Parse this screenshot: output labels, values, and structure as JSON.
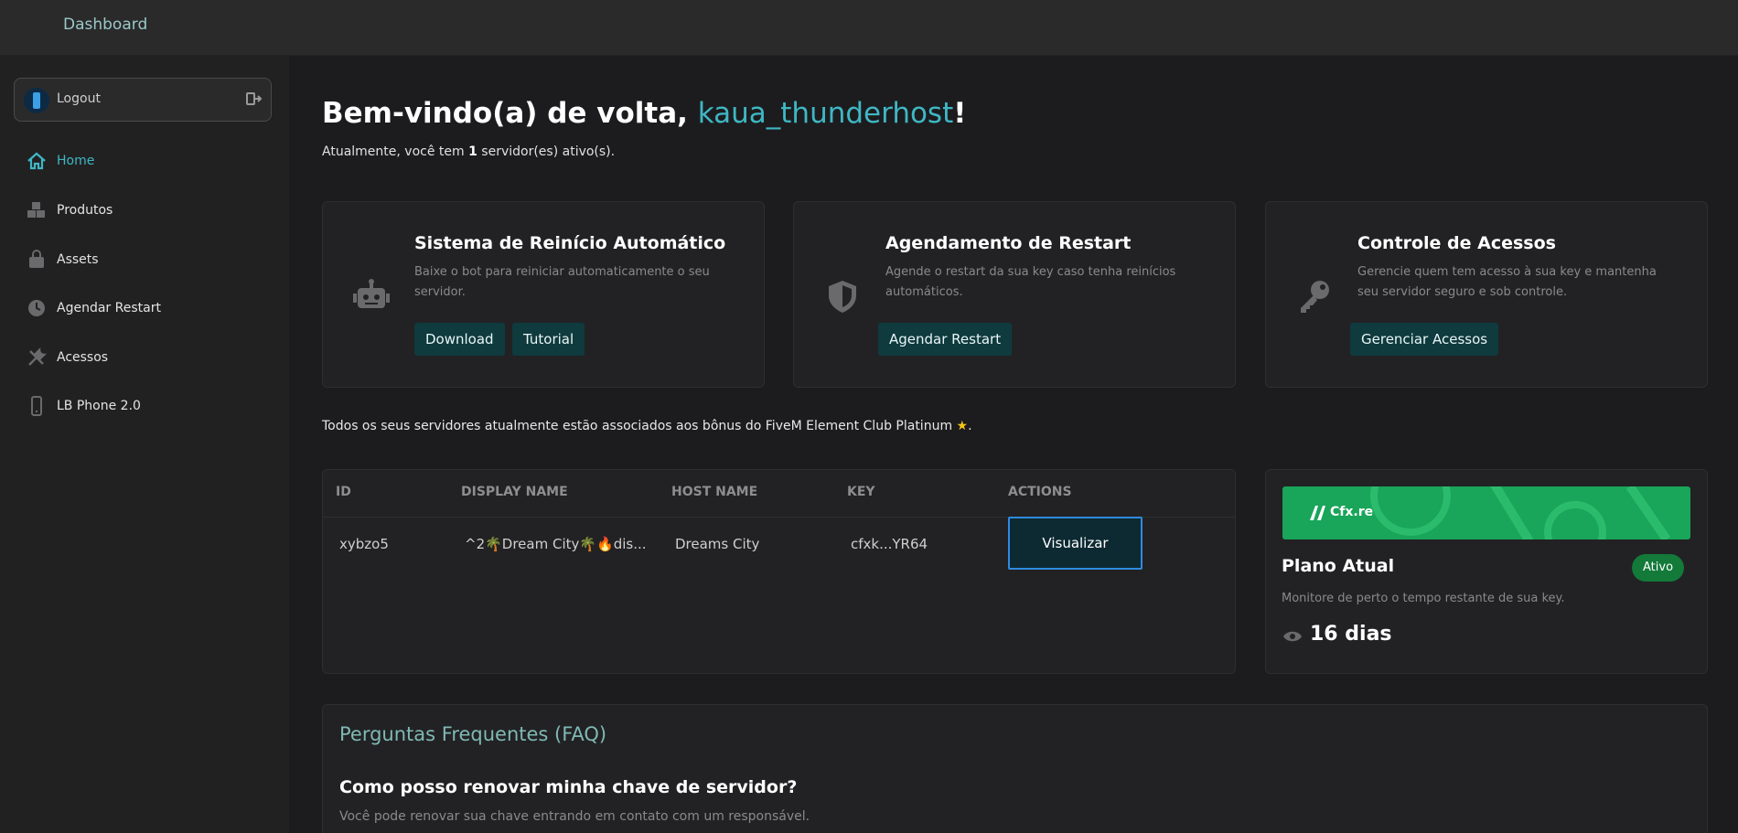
{
  "topbar": {
    "title": "Dashboard"
  },
  "sidebar": {
    "logout_label": "Logout",
    "items": [
      {
        "label": "Home",
        "icon": "home-icon"
      },
      {
        "label": "Produtos",
        "icon": "boxes-icon"
      },
      {
        "label": "Assets",
        "icon": "bag-icon"
      },
      {
        "label": "Agendar Restart",
        "icon": "clock-icon"
      },
      {
        "label": "Acessos",
        "icon": "tools-icon"
      },
      {
        "label": "LB Phone 2.0",
        "icon": "phone-icon"
      }
    ]
  },
  "welcome": {
    "prefix": "Bem-vindo(a) de volta, ",
    "username": "kaua_thunderhost",
    "suffix": "!",
    "subtitle_pre": "Atualmente, você tem ",
    "server_count": "1",
    "subtitle_post": " servidor(es) ativo(s)."
  },
  "cards": [
    {
      "title": "Sistema de Reinício Automático",
      "desc": "Baixe o bot para reiniciar automaticamente o seu servidor.",
      "icon": "robot-icon",
      "buttons": [
        "Download",
        "Tutorial"
      ]
    },
    {
      "title": "Agendamento de Restart",
      "desc": "Agende o restart da sua key caso tenha reinícios automáticos.",
      "icon": "shield-icon",
      "buttons": [
        "Agendar Restart"
      ]
    },
    {
      "title": "Controle de Acessos",
      "desc": "Gerencie quem tem acesso à sua key e mantenha seu servidor seguro e sob controle.",
      "icon": "key-icon",
      "buttons": [
        "Gerenciar Acessos"
      ]
    }
  ],
  "club_notice": {
    "text": "Todos os seus servidores atualmente estão associados aos bônus do FiveM Element Club Platinum ",
    "star": "★",
    "end": "."
  },
  "table": {
    "headers": [
      "ID",
      "DISPLAY NAME",
      "HOST NAME",
      "KEY",
      "ACTIONS"
    ],
    "rows": [
      {
        "id": "xybzo5",
        "display_name": "^2🌴Dream City🌴🔥dis...",
        "host_name": "Dreams City",
        "key": "cfxk...YR64",
        "action": "Visualizar"
      }
    ]
  },
  "plan": {
    "banner_logo": "Cfx.re",
    "title": "Plano Atual",
    "status": "Ativo",
    "desc": "Monitore de perto o tempo restante de sua key.",
    "days": "16 dias",
    "status_color": "#137a3a"
  },
  "faq": {
    "title": "Perguntas Frequentes (FAQ)",
    "question": "Como posso renovar minha chave de servidor?",
    "answer": "Você pode renovar sua chave entrando em contato com um responsável."
  },
  "colors": {
    "accent": "#3fb7c4",
    "button_bg": "#0f3a3e",
    "focus_border": "#2f8be0"
  }
}
